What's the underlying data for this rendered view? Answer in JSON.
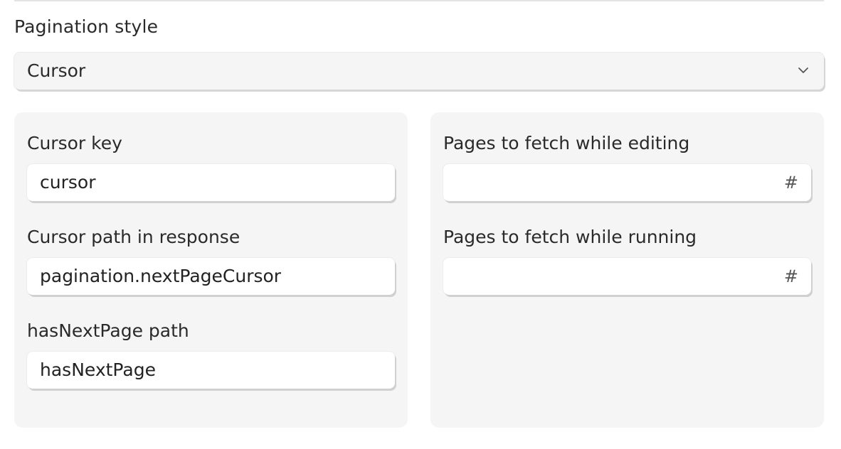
{
  "pagination": {
    "label": "Pagination style",
    "selected": "Cursor"
  },
  "left_panel": {
    "cursor_key": {
      "label": "Cursor key",
      "value": "cursor"
    },
    "cursor_path": {
      "label": "Cursor path in response",
      "value": "pagination.nextPageCursor"
    },
    "has_next_page": {
      "label": "hasNextPage path",
      "value": "hasNextPage"
    }
  },
  "right_panel": {
    "pages_editing": {
      "label": "Pages to fetch while editing",
      "value": "",
      "icon": "#"
    },
    "pages_running": {
      "label": "Pages to fetch while running",
      "value": "",
      "icon": "#"
    }
  }
}
